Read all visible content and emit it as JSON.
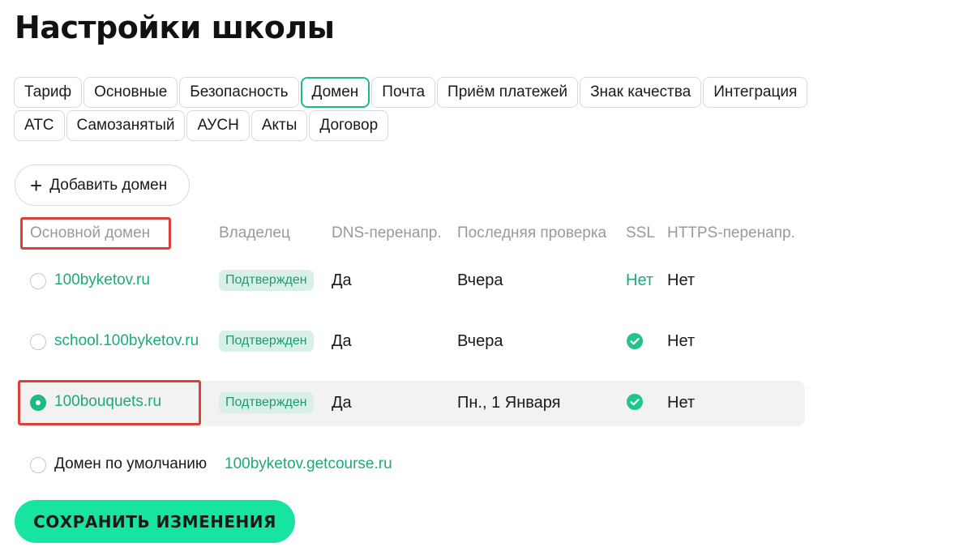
{
  "page": {
    "title": "Настройки школы"
  },
  "tabs": [
    {
      "label": "Тариф"
    },
    {
      "label": "Основные"
    },
    {
      "label": "Безопасность"
    },
    {
      "label": "Домен"
    },
    {
      "label": "Почта"
    },
    {
      "label": "Приём платежей"
    },
    {
      "label": "Знак качества"
    },
    {
      "label": "Интеграция"
    },
    {
      "label": "АТС"
    },
    {
      "label": "Самозанятый"
    },
    {
      "label": "АУСН"
    },
    {
      "label": "Акты"
    },
    {
      "label": "Договор"
    }
  ],
  "active_tab": "Домен",
  "add_domain": {
    "icon": "+",
    "label": "Добавить домен"
  },
  "columns": {
    "primary": "Основной домен",
    "owner": "Владелец",
    "dns": "DNS-перенапр.",
    "last_check": "Последняя проверка",
    "ssl": "SSL",
    "https": "HTTPS-перенапр."
  },
  "rows": [
    {
      "domain": "100byketov.ru",
      "owner": "Подтвержден",
      "dns": "Да",
      "last_check": "Вчера",
      "ssl": "Нет",
      "https": "Нет",
      "selected": false
    },
    {
      "domain": "school.100byketov.ru",
      "owner": "Подтвержден",
      "dns": "Да",
      "last_check": "Вчера",
      "ssl": "check-icon",
      "https": "Нет",
      "selected": false
    },
    {
      "domain": "100bouquets.ru",
      "owner": "Подтвержден",
      "dns": "Да",
      "last_check": "Пн., 1 Января",
      "ssl": "check-icon",
      "https": "Нет",
      "selected": true
    }
  ],
  "default_domain": {
    "label": "Домен по умолчанию",
    "domain": "100byketov.getcourse.ru",
    "selected": false
  },
  "save_button": {
    "label": "СОХРАНИТЬ ИЗМЕНЕНИЯ"
  },
  "colors": {
    "accent": "#1fb886",
    "link": "#1fa97a",
    "badge_bg": "#d8f0e6",
    "highlight": "#d9413b",
    "save_bg": "#16e4a0"
  }
}
